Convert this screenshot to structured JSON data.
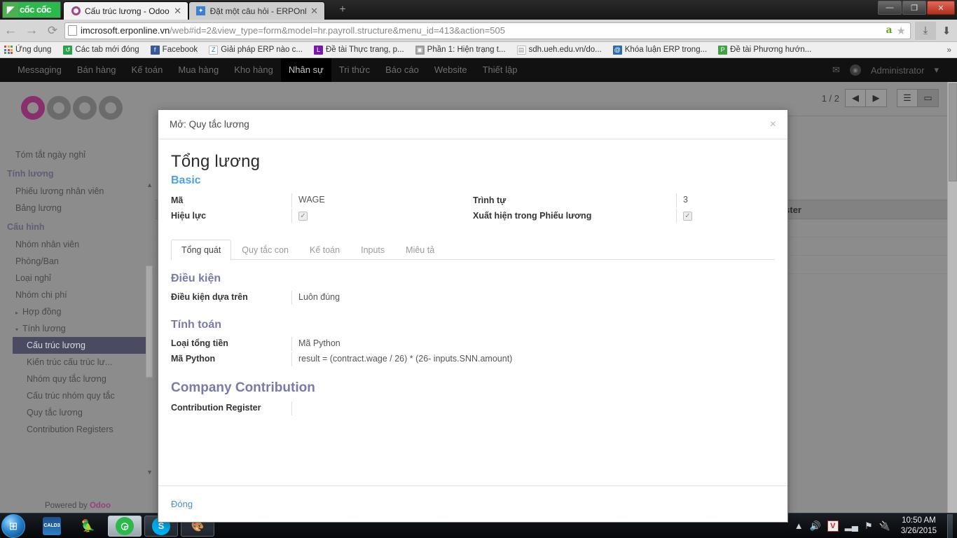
{
  "browser": {
    "brand": "cốc cốc",
    "tabs": [
      {
        "title": "Cấu trúc lương - Odoo",
        "favicon": "odoo-ring-icon",
        "active": true,
        "close": "✕"
      },
      {
        "title": "Đặt một câu hỏi - ERPOnli",
        "favicon": "erp-icon",
        "active": false,
        "close": "✕"
      }
    ],
    "new_tab_label": "+",
    "nav": {
      "back": "←",
      "forward": "→",
      "reload": "⟳"
    },
    "url_bold": "imcrosoft.erponline.vn",
    "url_dim": "/web#id=2&view_type=form&model=hr.payroll.structure&menu_id=413&action=505",
    "omnibox_icons": [
      "amazon-icon",
      "star-icon"
    ],
    "download_icons": [
      "download-tray-icon",
      "download-arrow-icon"
    ],
    "window_controls": {
      "minimize": "—",
      "maximize": "❐",
      "close": "✕"
    },
    "bookmarks": {
      "apps_label": "Ứng dụng",
      "items": [
        {
          "label": "Các tab mới đóng",
          "icon": "history-icon",
          "color": "#2aa04a",
          "glyph": "↺"
        },
        {
          "label": "Facebook",
          "icon": "facebook-icon",
          "color": "#3b5998",
          "glyph": "f"
        },
        {
          "label": "Giải pháp ERP nào c...",
          "icon": "zalo-icon",
          "color": "#ffffff",
          "glyph": "Z"
        },
        {
          "label": "Đề tài Thực trang, p...",
          "icon": "onenote-icon",
          "color": "#7719aa",
          "glyph": "L"
        },
        {
          "label": "Phần 1: Hiện trạng t...",
          "icon": "archive-icon",
          "color": "#9c9c9c",
          "glyph": "▣"
        },
        {
          "label": "sdh.ueh.edu.vn/do...",
          "icon": "page-icon",
          "color": "#ffffff",
          "glyph": "▤"
        },
        {
          "label": "Khóa luận ERP trong...",
          "icon": "mail-doc-icon",
          "color": "#2b6cb0",
          "glyph": "@"
        },
        {
          "label": "Đề tài Phương hướn...",
          "icon": "powerpoint-icon",
          "color": "#43a047",
          "glyph": "P"
        }
      ],
      "overflow": "»"
    }
  },
  "odoo": {
    "menu": [
      {
        "label": "Messaging",
        "active": false
      },
      {
        "label": "Bán hàng",
        "active": false
      },
      {
        "label": "Kế toán",
        "active": false
      },
      {
        "label": "Mua hàng",
        "active": false
      },
      {
        "label": "Kho hàng",
        "active": false
      },
      {
        "label": "Nhân sự",
        "active": true
      },
      {
        "label": "Tri thức",
        "active": false
      },
      {
        "label": "Báo cáo",
        "active": false
      },
      {
        "label": "Website",
        "active": false
      },
      {
        "label": "Thiết lập",
        "active": false
      }
    ],
    "user": "Administrator",
    "user_caret": "▾",
    "mail_icon": "envelope-icon",
    "logo_alt": "odoo",
    "powered_by": "Powered by",
    "powered_brand": "Odoo",
    "sidebar": [
      {
        "label": "Tóm tắt ngày nghỉ",
        "type": "item"
      },
      {
        "label": "Tính lương",
        "type": "section"
      },
      {
        "label": "Phiếu lương nhân viên",
        "type": "item"
      },
      {
        "label": "Bảng lương",
        "type": "item"
      },
      {
        "label": "Cấu hình",
        "type": "section"
      },
      {
        "label": "Nhóm nhân viên",
        "type": "item"
      },
      {
        "label": "Phòng/Ban",
        "type": "item"
      },
      {
        "label": "Loại nghỉ",
        "type": "item"
      },
      {
        "label": "Nhóm chi phí",
        "type": "item"
      },
      {
        "label": "Hợp đồng",
        "type": "group",
        "caret": "▸"
      },
      {
        "label": "Tính lương",
        "type": "group",
        "caret": "▾"
      },
      {
        "label": "Cấu trúc lương",
        "type": "sub",
        "selected": true
      },
      {
        "label": "Kiến trúc cấu trúc lư...",
        "type": "sub"
      },
      {
        "label": "Nhóm quy tắc lương",
        "type": "sub"
      },
      {
        "label": "Cấu trúc nhóm quy tắc",
        "type": "sub"
      },
      {
        "label": "Quy tắc lương",
        "type": "sub"
      },
      {
        "label": "Contribution Registers",
        "type": "sub"
      }
    ],
    "background": {
      "pager": "1 / 2",
      "prev": "◀",
      "next": "▶",
      "list_view": "☰",
      "form_view": "▭",
      "column_label": "Register"
    }
  },
  "modal": {
    "header_title": "Mở: Quy tắc lương",
    "close_glyph": "×",
    "record_title": "Tổng lương",
    "basic_section": "Basic",
    "basic_fields_left": [
      {
        "label": "Mã",
        "value": "WAGE",
        "type": "text"
      },
      {
        "label": "Hiệu lực",
        "value": "✓",
        "type": "checkbox"
      }
    ],
    "basic_fields_right": [
      {
        "label": "Trình tự",
        "value": "3",
        "type": "text"
      },
      {
        "label": "Xuất hiện trong Phiếu lương",
        "value": "✓",
        "type": "checkbox"
      }
    ],
    "tabs": [
      {
        "label": "Tổng quát",
        "active": true
      },
      {
        "label": "Quy tắc con",
        "active": false
      },
      {
        "label": "Kế toán",
        "active": false
      },
      {
        "label": "Inputs",
        "active": false
      },
      {
        "label": "Miêu tả",
        "active": false
      }
    ],
    "sections": [
      {
        "heading": "Điều kiện",
        "size": "normal",
        "fields": [
          {
            "label": "Điều kiện dựa trên",
            "value": "Luôn đúng"
          }
        ]
      },
      {
        "heading": "Tính toán",
        "size": "normal",
        "fields": [
          {
            "label": "Loại tổng tiền",
            "value": "Mã Python"
          },
          {
            "label": "Mã Python",
            "value": "result = (contract.wage / 26) * (26- inputs.SNN.amount)"
          }
        ]
      },
      {
        "heading": "Company Contribution",
        "size": "big",
        "fields": [
          {
            "label": "Contribution Register",
            "value": ""
          }
        ]
      }
    ],
    "footer_close": "Đóng"
  },
  "taskbar": {
    "start": "⊞",
    "items": [
      {
        "name": "cald3",
        "glyph": "CALD3",
        "color": "#1b4f8c",
        "state": "plain"
      },
      {
        "name": "parrot-app",
        "glyph": "🦜",
        "color": "transparent",
        "state": "plain"
      },
      {
        "name": "coccoc-browser",
        "glyph": "◶",
        "color": "#2db84c",
        "state": "active"
      },
      {
        "name": "skype",
        "glyph": "S",
        "color": "#00aff0",
        "state": "framed"
      },
      {
        "name": "paint",
        "glyph": "🎨",
        "color": "#7a5ea8",
        "state": "framed"
      }
    ],
    "tray": {
      "expand": "▲",
      "volume": "🔊",
      "antivirus": "V",
      "network": "▂▄",
      "flag": "⚑",
      "power": "🔌",
      "time": "10:50 AM",
      "date": "3/26/2015"
    }
  },
  "colors": {
    "accent_blue": "#4ba3e3",
    "section_purple": "#7a7aa8",
    "odoo_pink": "#8a2f6e",
    "selected_nav": "#4a4a60"
  }
}
